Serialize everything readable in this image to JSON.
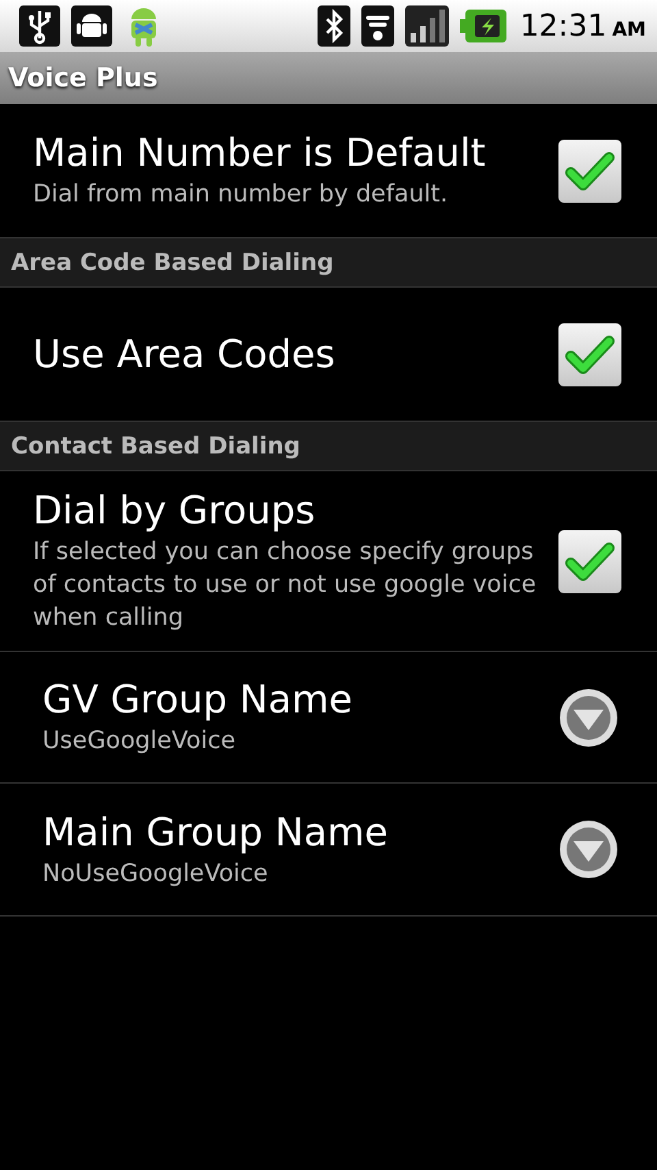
{
  "status_bar": {
    "time": "12:31",
    "meridiem": "AM"
  },
  "title_bar": {
    "title": "Voice Plus"
  },
  "items": [
    {
      "kind": "checkbox",
      "title": "Main Number is Default",
      "summary": "Dial from main number by default.",
      "checked": true
    },
    {
      "kind": "header",
      "title": "Area Code Based Dialing"
    },
    {
      "kind": "checkbox",
      "title": "Use Area Codes",
      "checked": true
    },
    {
      "kind": "header",
      "title": "Contact Based Dialing"
    },
    {
      "kind": "checkbox",
      "title": "Dial by Groups",
      "summary": "If selected you can choose specify groups of contacts to use or not use google voice when calling",
      "checked": true
    },
    {
      "kind": "dropdown",
      "title": "GV Group Name",
      "summary": "UseGoogleVoice"
    },
    {
      "kind": "dropdown",
      "title": "Main Group Name",
      "summary": "NoUseGoogleVoice"
    }
  ]
}
